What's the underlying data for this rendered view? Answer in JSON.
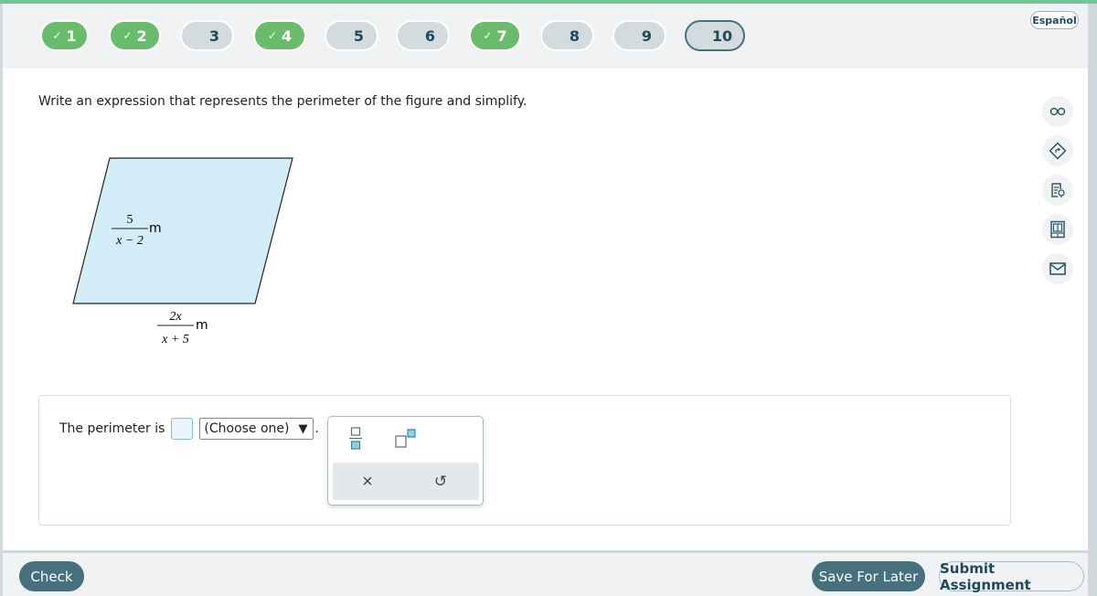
{
  "nav": {
    "questions": [
      {
        "label": "1",
        "status": "done"
      },
      {
        "label": "2",
        "status": "done"
      },
      {
        "label": "3",
        "status": "todo"
      },
      {
        "label": "4",
        "status": "done"
      },
      {
        "label": "5",
        "status": "todo"
      },
      {
        "label": "6",
        "status": "todo"
      },
      {
        "label": "7",
        "status": "done"
      },
      {
        "label": "8",
        "status": "todo"
      },
      {
        "label": "9",
        "status": "todo"
      },
      {
        "label": "10",
        "status": "current"
      }
    ],
    "check_glyph": "✓",
    "language_label": "Español"
  },
  "question": {
    "prompt": "Write an expression that represents the perimeter of the figure and simplify.",
    "figure": {
      "shape": "parallelogram",
      "fill": "#d4eef9",
      "side_label": {
        "numerator": "5",
        "denominator": "x − 2",
        "unit": "m"
      },
      "base_label": {
        "numerator": "2x",
        "denominator": "x + 5",
        "unit": "m"
      }
    }
  },
  "tools": [
    {
      "name": "glasses-icon"
    },
    {
      "name": "directions-icon"
    },
    {
      "name": "notes-hint-icon"
    },
    {
      "name": "ebook-icon"
    },
    {
      "name": "mail-icon"
    }
  ],
  "answer": {
    "prefix": "The perimeter is",
    "input_value": "",
    "select_value": "(Choose one)",
    "select_arrow": "▼",
    "period": "."
  },
  "palette": {
    "fraction_label": "fraction",
    "superscript_label": "superscript",
    "clear_glyph": "×",
    "undo_glyph": "↺"
  },
  "footer": {
    "check_label": "Check",
    "save_label": "Save For Later",
    "submit_label": "Submit Assignment"
  },
  "colors": {
    "done": "#68bc6b",
    "todo": "#d3dbde",
    "accent": "#46707d",
    "topbar": "#73c597"
  }
}
